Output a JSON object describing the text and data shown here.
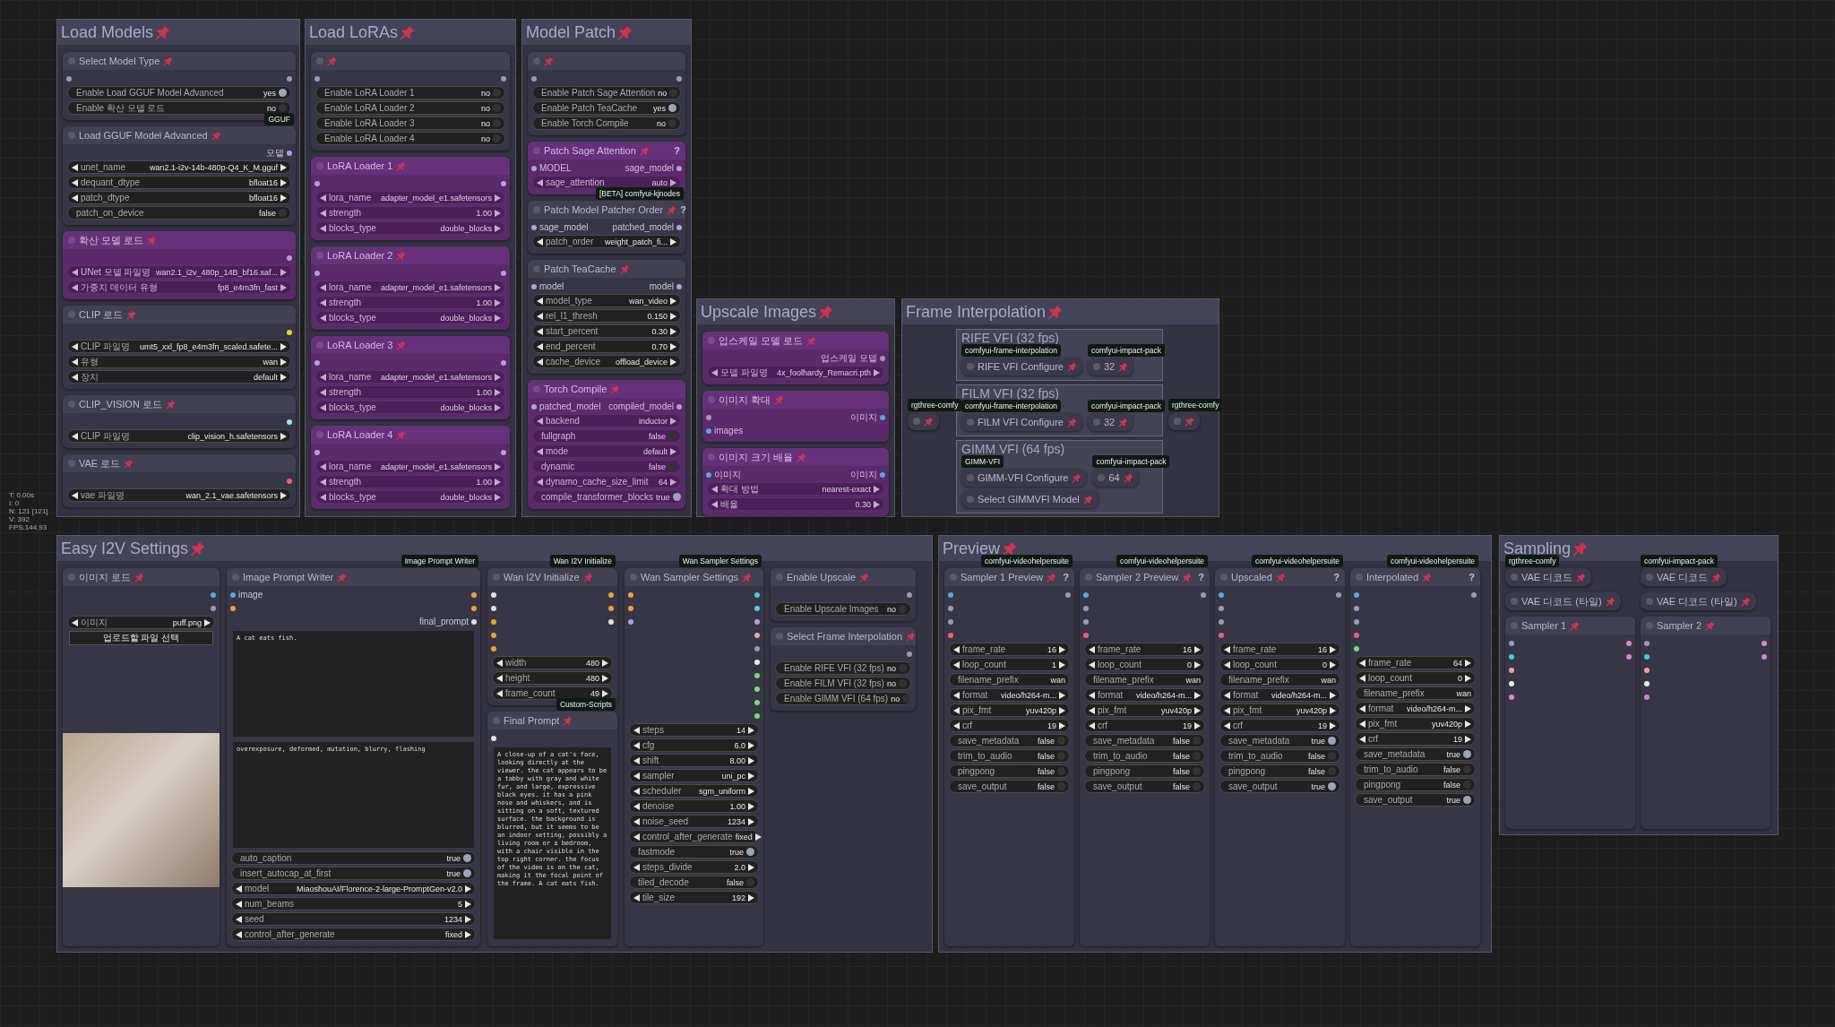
{
  "stats": [
    "T: 0.00s",
    "I: 0",
    "N: 121 [121]",
    "V: 392",
    "FPS:144.93"
  ],
  "groups": [
    {
      "title": "Load Models",
      "columns": [
        [
          {
            "kind": "node",
            "title": "Select Model Type",
            "bypassed": false,
            "inputs": [
              {
                "color": "#9a9ab0"
              }
            ],
            "outputs": [
              {
                "color": "#9a9ab0"
              }
            ],
            "widgets": [
              {
                "kind": "toggle",
                "label": "Enable Load GGUF Model Advanced",
                "value": "yes",
                "on": true
              },
              {
                "kind": "toggle",
                "label": "Enable 확산 모델 로드",
                "value": "no",
                "on": false
              }
            ]
          },
          {
            "kind": "node",
            "title": "Load GGUF Model Advanced",
            "badge": "GGUF",
            "bypassed": false,
            "outputs": [
              {
                "label": "모델",
                "color": "#b39ddb"
              }
            ],
            "widgets": [
              {
                "kind": "combo",
                "label": "unet_name",
                "value": "wan2.1-i2v-14b-480p-Q4_K_M.gguf"
              },
              {
                "kind": "combo",
                "label": "dequant_dtype",
                "value": "bfloat16"
              },
              {
                "kind": "combo",
                "label": "patch_dtype",
                "value": "bfloat16"
              },
              {
                "kind": "toggle",
                "label": "patch_on_device",
                "value": "false",
                "on": false
              }
            ]
          },
          {
            "kind": "node",
            "title": "확산 모델 로드",
            "bypassed": true,
            "outputs": [
              {
                "color": "#b39ddb"
              }
            ],
            "widgets": [
              {
                "kind": "combo",
                "label": "UNet 모델 파일명",
                "value": "wan2.1_i2v_480p_14B_bf16.saf..."
              },
              {
                "kind": "combo",
                "label": "가중치 데이터 유형",
                "value": "fp8_e4m3fn_fast"
              }
            ]
          },
          {
            "kind": "node",
            "title": "CLIP 로드",
            "bypassed": false,
            "outputs": [
              {
                "color": "#f0d020"
              }
            ],
            "widgets": [
              {
                "kind": "combo",
                "label": "CLIP 파일명",
                "value": "umt5_xxl_fp8_e4m3fn_scaled.safete..."
              },
              {
                "kind": "combo",
                "label": "유형",
                "value": "wan"
              },
              {
                "kind": "combo",
                "label": "장치",
                "value": "default"
              }
            ]
          },
          {
            "kind": "node",
            "title": "CLIP_VISION 로드",
            "bypassed": false,
            "outputs": [
              {
                "color": "#a0e0f0"
              }
            ],
            "widgets": [
              {
                "kind": "combo",
                "label": "CLIP 파일명",
                "value": "clip_vision_h.safetensors"
              }
            ]
          },
          {
            "kind": "node",
            "title": "VAE 로드",
            "bypassed": false,
            "outputs": [
              {
                "color": "#f06070"
              }
            ],
            "widgets": [
              {
                "kind": "combo",
                "label": "vae 파일명",
                "value": "wan_2.1_vae.safetensors"
              }
            ]
          }
        ]
      ]
    },
    {
      "title": "Load LoRAs",
      "columns": [
        [
          {
            "kind": "node",
            "bypassed": false,
            "inputs": [
              {
                "color": "#9a9ab0"
              }
            ],
            "outputs": [
              {
                "color": "#9a9ab0"
              }
            ],
            "widgets": [
              {
                "kind": "toggle",
                "label": "Enable LoRA Loader 1",
                "value": "no",
                "on": false
              },
              {
                "kind": "toggle",
                "label": "Enable LoRA Loader 2",
                "value": "no",
                "on": false
              },
              {
                "kind": "toggle",
                "label": "Enable LoRA Loader 3",
                "value": "no",
                "on": false
              },
              {
                "kind": "toggle",
                "label": "Enable LoRA Loader 4",
                "value": "no",
                "on": false
              }
            ]
          },
          {
            "kind": "node",
            "title": "LoRA Loader 1",
            "bypassed": true,
            "inputs": [
              {
                "color": "#b39ddb"
              }
            ],
            "outputs": [
              {
                "color": "#b39ddb"
              }
            ],
            "widgets": [
              {
                "kind": "combo",
                "label": "lora_name",
                "value": "adapter_model_e1.safetensors"
              },
              {
                "kind": "combo",
                "label": "strength",
                "value": "1.00"
              },
              {
                "kind": "combo",
                "label": "blocks_type",
                "value": "double_blocks"
              }
            ]
          },
          {
            "kind": "node",
            "title": "LoRA Loader 2",
            "bypassed": true,
            "inputs": [
              {
                "color": "#b39ddb"
              }
            ],
            "outputs": [
              {
                "color": "#b39ddb"
              }
            ],
            "widgets": [
              {
                "kind": "combo",
                "label": "lora_name",
                "value": "adapter_model_e1.safetensors"
              },
              {
                "kind": "combo",
                "label": "strength",
                "value": "1.00"
              },
              {
                "kind": "combo",
                "label": "blocks_type",
                "value": "double_blocks"
              }
            ]
          },
          {
            "kind": "node",
            "title": "LoRA Loader 3",
            "bypassed": true,
            "inputs": [
              {
                "color": "#b39ddb"
              }
            ],
            "outputs": [
              {
                "color": "#b39ddb"
              }
            ],
            "widgets": [
              {
                "kind": "combo",
                "label": "lora_name",
                "value": "adapter_model_e1.safetensors"
              },
              {
                "kind": "combo",
                "label": "strength",
                "value": "1.00"
              },
              {
                "kind": "combo",
                "label": "blocks_type",
                "value": "double_blocks"
              }
            ]
          },
          {
            "kind": "node",
            "title": "LoRA Loader 4",
            "bypassed": true,
            "inputs": [
              {
                "color": "#b39ddb"
              }
            ],
            "outputs": [
              {
                "color": "#b39ddb"
              }
            ],
            "widgets": [
              {
                "kind": "combo",
                "label": "lora_name",
                "value": "adapter_model_e1.safetensors"
              },
              {
                "kind": "combo",
                "label": "strength",
                "value": "1.00"
              },
              {
                "kind": "combo",
                "label": "blocks_type",
                "value": "double_blocks"
              }
            ]
          }
        ]
      ]
    },
    {
      "title": "Model Patch",
      "columns": [
        [
          {
            "kind": "node",
            "bypassed": false,
            "inputs": [
              {
                "color": "#9a9ab0"
              }
            ],
            "outputs": [
              {
                "color": "#9a9ab0"
              }
            ],
            "widgets": [
              {
                "kind": "toggle",
                "label": "Enable Patch Sage Attention",
                "value": "no",
                "on": false
              },
              {
                "kind": "toggle",
                "label": "Enable Patch TeaCache",
                "value": "yes",
                "on": true
              },
              {
                "kind": "toggle",
                "label": "Enable Torch Compile",
                "value": "no",
                "on": false
              }
            ]
          },
          {
            "kind": "node",
            "title": "Patch Sage Attention",
            "help": "?",
            "bypassed": true,
            "inputs": [
              {
                "label": "MODEL",
                "color": "#b39ddb"
              }
            ],
            "outputs": [
              {
                "label": "sage_model",
                "color": "#b39ddb"
              }
            ],
            "widgets": [
              {
                "kind": "combo",
                "label": "sage_attention",
                "value": "auto"
              }
            ]
          },
          {
            "kind": "node",
            "title": "Patch Model Patcher Order",
            "help": "?",
            "badge": "[BETA] comfyui-kjnodes",
            "bypassed": false,
            "inputs": [
              {
                "label": "sage_model",
                "color": "#b39ddb"
              }
            ],
            "outputs": [
              {
                "label": "patched_model",
                "color": "#b39ddb"
              }
            ],
            "widgets": [
              {
                "kind": "combo",
                "label": "patch_order",
                "value": "weight_patch_fi..."
              }
            ]
          },
          {
            "kind": "node",
            "title": "Patch TeaCache",
            "bypassed": false,
            "inputs": [
              {
                "label": "model",
                "color": "#b39ddb"
              }
            ],
            "outputs": [
              {
                "label": "model",
                "color": "#b39ddb"
              }
            ],
            "widgets": [
              {
                "kind": "combo",
                "label": "model_type",
                "value": "wan_video"
              },
              {
                "kind": "combo",
                "label": "rel_l1_thresh",
                "value": "0.150"
              },
              {
                "kind": "combo",
                "label": "start_percent",
                "value": "0.30"
              },
              {
                "kind": "combo",
                "label": "end_percent",
                "value": "0.70"
              },
              {
                "kind": "combo",
                "label": "cache_device",
                "value": "offload_device"
              }
            ]
          },
          {
            "kind": "node",
            "title": "Torch Compile",
            "bypassed": true,
            "inputs": [
              {
                "label": "patched_model",
                "color": "#b39ddb"
              }
            ],
            "outputs": [
              {
                "label": "compiled_model",
                "color": "#b39ddb"
              }
            ],
            "widgets": [
              {
                "kind": "combo",
                "label": "backend",
                "value": "inductor"
              },
              {
                "kind": "toggle",
                "label": "fullgraph",
                "value": "false",
                "on": false
              },
              {
                "kind": "combo",
                "label": "mode",
                "value": "default"
              },
              {
                "kind": "toggle",
                "label": "dynamic",
                "value": "false",
                "on": false
              },
              {
                "kind": "combo",
                "label": "dynamo_cache_size_limit",
                "value": "64"
              },
              {
                "kind": "toggle",
                "label": "compile_transformer_blocks",
                "value": "true",
                "on": true
              }
            ]
          }
        ]
      ]
    },
    {
      "title": "Upscale Images",
      "columns": [
        [
          {
            "kind": "node",
            "title": "업스케일 모델 로드",
            "bypassed": true,
            "outputs": [
              {
                "label": "업스케일 모델",
                "color": "#9a9ab0"
              }
            ],
            "widgets": [
              {
                "kind": "combo",
                "label": "모델 파일명",
                "value": "4x_foolhardy_Remacri.pth"
              }
            ]
          },
          {
            "kind": "node",
            "title": "이미지 확대",
            "bypassed": true,
            "inputs": [
              {
                "color": "#9a9ab0"
              },
              {
                "label": "images",
                "color": "#50a8f0"
              }
            ],
            "outputs": [
              {
                "label": "이미지",
                "color": "#50a8f0"
              }
            ]
          },
          {
            "kind": "node",
            "title": "이미지 크기 배율",
            "bypassed": true,
            "inputs": [
              {
                "label": "이미지",
                "color": "#50a8f0"
              }
            ],
            "outputs": [
              {
                "label": "이미지",
                "color": "#50a8f0"
              }
            ],
            "widgets": [
              {
                "kind": "combo",
                "label": "확대 방법",
                "value": "nearest-exact"
              },
              {
                "kind": "combo",
                "label": "배율",
                "value": "0.30"
              }
            ]
          }
        ]
      ]
    },
    {
      "title": "Frame Interpolation",
      "columns": [
        [
          {
            "kind": "collapsed",
            "badge": "rgthree-comfy",
            "bypassed": false
          }
        ],
        [
          {
            "kind": "group",
            "title": "RIFE VFI (32 fps)",
            "nodes": [
              {
                "kind": "collapsed",
                "title": "RIFE VFI Configure",
                "badge": "comfyui-frame-interpolation",
                "bypassed": false
              },
              {
                "kind": "collapsed",
                "title": "32",
                "badge": "comfyui-impact-pack",
                "bypassed": false
              }
            ]
          },
          {
            "kind": "group",
            "title": "FILM VFI (32 fps)",
            "nodes": [
              {
                "kind": "collapsed",
                "title": "FILM VFI Configure",
                "badge": "comfyui-frame-interpolation",
                "bypassed": false
              },
              {
                "kind": "collapsed",
                "title": "32",
                "badge": "comfyui-impact-pack",
                "bypassed": false
              }
            ]
          },
          {
            "kind": "group",
            "title": "GIMM VFI (64 fps)",
            "nodes": [
              {
                "kind": "collapsed",
                "title": "GIMM-VFI Configure",
                "badge": "GIMM-VFI",
                "bypassed": false
              },
              {
                "kind": "collapsed",
                "title": "64",
                "badge": "comfyui-impact-pack",
                "bypassed": false
              },
              {
                "kind": "collapsed",
                "title": "Select GIMMVFI Model",
                "bypassed": false
              }
            ]
          }
        ],
        [
          {
            "kind": "collapsed",
            "badge": "rgthree-comfy",
            "bypassed": false
          }
        ]
      ]
    },
    {
      "title": "Easy I2V Settings",
      "columns": [
        [
          {
            "kind": "node",
            "title": "이미지 로드",
            "bypassed": false,
            "outputs": [
              {
                "color": "#50a8f0"
              },
              {
                "color": "#9a9ab0"
              }
            ],
            "widgets": [
              {
                "kind": "combo",
                "label": "이미지",
                "value": "puff.png"
              },
              {
                "kind": "button",
                "label": "업로드할 파일 선택"
              },
              {
                "kind": "image"
              }
            ]
          }
        ],
        [
          {
            "kind": "node",
            "title": "Image Prompt Writer",
            "badge": "Image Prompt Writer",
            "bypassed": false,
            "inputs": [
              {
                "label": "image",
                "color": "#50a8f0"
              },
              {
                "color": "#f0a030"
              }
            ],
            "outputs": [
              {
                "color": "#f0a030"
              },
              {
                "color": "#f0a030"
              },
              {
                "label": "final_prompt",
                "color": "#e0e0e0"
              }
            ],
            "widgets": [
              {
                "kind": "textarea",
                "value": "A cat eats fish."
              },
              {
                "kind": "textarea",
                "value": "overexposure, deformed, mutation, blurry, flashing"
              },
              {
                "kind": "toggle",
                "label": "auto_caption",
                "value": "true",
                "on": true
              },
              {
                "kind": "toggle",
                "label": "insert_autocap_at_first",
                "value": "true",
                "on": true
              },
              {
                "kind": "combo",
                "label": "model",
                "value": "MiaoshouAI/Florence-2-large-PromptGen-v2.0"
              },
              {
                "kind": "combo",
                "label": "num_beams",
                "value": "5"
              },
              {
                "kind": "combo",
                "label": "seed",
                "value": "1234"
              },
              {
                "kind": "combo",
                "label": "control_after_generate",
                "value": "fixed"
              }
            ]
          }
        ],
        [
          {
            "kind": "node",
            "title": "Wan I2V Initialize",
            "badge": "Wan I2V Initialize",
            "bypassed": false,
            "inputs": [
              {
                "color": "#e0e0e0"
              },
              {
                "color": "#e0e0e0"
              },
              {
                "color": "#f0a030"
              },
              {
                "color": "#f0a030"
              },
              {
                "color": "#f0a030"
              }
            ],
            "outputs": [
              {
                "color": "#f0a030"
              },
              {
                "color": "#f0a030"
              },
              {
                "color": "#e0e0e0"
              }
            ],
            "widgets": [
              {
                "kind": "combo",
                "label": "width",
                "value": "480"
              },
              {
                "kind": "combo",
                "label": "height",
                "value": "480"
              },
              {
                "kind": "combo",
                "label": "frame_count",
                "value": "49"
              }
            ]
          },
          {
            "kind": "node",
            "title": "Final Prompt",
            "badge": "Custom-Scripts",
            "bypassed": false,
            "inputs": [
              {
                "color": "#e0e0e0"
              }
            ],
            "widgets": [
              {
                "kind": "textarea",
                "value": "A close-up of a cat's face, looking directly at the viewer. the cat appears to be a tabby with gray and white fur, and large, expressive black eyes. it has a pink nose and whiskers, and is sitting on a soft, textured surface. the background is blurred, but it seems to be an indoor setting, possibly a living room or a bedroom, with a chair visible in the top right corner. the focus of the video is on the cat, making it the focal point of the frame. A cat eats fish."
              }
            ]
          }
        ],
        [
          {
            "kind": "node",
            "title": "Wan Sampler Settings",
            "badge": "Wan Sampler Settings",
            "bypassed": false,
            "inputs": [
              {
                "color": "#f0a030"
              },
              {
                "color": "#f0a030"
              },
              {
                "color": "#b39ddb"
              }
            ],
            "outputs": [
              {
                "color": "#40d0e0"
              },
              {
                "color": "#40d0e0"
              },
              {
                "color": "#b39ddb"
              },
              {
                "color": "#f0a0a0"
              },
              {
                "color": "#9a9ab0"
              },
              {
                "color": "#e0f0e0"
              },
              {
                "color": "#70e070"
              },
              {
                "color": "#70e070"
              },
              {
                "color": "#70e070"
              },
              {
                "color": "#70e070"
              }
            ],
            "widgets": [
              {
                "kind": "combo",
                "label": "steps",
                "value": "14"
              },
              {
                "kind": "combo",
                "label": "cfg",
                "value": "6.0"
              },
              {
                "kind": "combo",
                "label": "shift",
                "value": "8.00"
              },
              {
                "kind": "combo",
                "label": "sampler",
                "value": "uni_pc"
              },
              {
                "kind": "combo",
                "label": "scheduler",
                "value": "sgm_uniform"
              },
              {
                "kind": "combo",
                "label": "denoise",
                "value": "1.00"
              },
              {
                "kind": "combo",
                "label": "noise_seed",
                "value": "1234"
              },
              {
                "kind": "combo",
                "label": "control_after_generate",
                "value": "fixed"
              },
              {
                "kind": "toggle",
                "label": "fastmode",
                "value": "true",
                "on": true
              },
              {
                "kind": "combo",
                "label": "steps_divide",
                "value": "2.0"
              },
              {
                "kind": "toggle",
                "label": "tiled_decode",
                "value": "false",
                "on": false
              },
              {
                "kind": "combo",
                "label": "tile_size",
                "value": "192"
              }
            ]
          }
        ],
        [
          {
            "kind": "node",
            "title": "Enable Upscale",
            "bypassed": false,
            "outputs": [
              {
                "color": "#9a9ab0"
              }
            ],
            "widgets": [
              {
                "kind": "toggle",
                "label": "Enable Upscale Images",
                "value": "no",
                "on": false
              }
            ]
          },
          {
            "kind": "node",
            "title": "Select Frame Interpolation",
            "bypassed": false,
            "outputs": [
              {
                "color": "#9a9ab0"
              }
            ],
            "widgets": [
              {
                "kind": "toggle",
                "label": "Enable RIFE VFI (32 fps)",
                "value": "no",
                "on": false
              },
              {
                "kind": "toggle",
                "label": "Enable FILM VFI (32 fps)",
                "value": "no",
                "on": false
              },
              {
                "kind": "toggle",
                "label": "Enable GIMM VFI (64 fps)",
                "value": "no",
                "on": false
              }
            ]
          }
        ]
      ]
    },
    {
      "title": "Preview",
      "columns": [
        [
          {
            "kind": "node",
            "title": "Sampler 1 Preview",
            "help": "?",
            "badge": "comfyui-videohelpersuite",
            "bypassed": false,
            "inputs": [
              {
                "color": "#50a8f0"
              },
              {
                "color": "#9a9ab0"
              },
              {
                "color": "#9a9ab0"
              },
              {
                "color": "#f06070"
              }
            ],
            "outputs": [
              {
                "color": "#9a9ab0"
              }
            ],
            "widgets": [
              {
                "kind": "combo",
                "label": "frame_rate",
                "value": "16"
              },
              {
                "kind": "combo",
                "label": "loop_count",
                "value": "1"
              },
              {
                "kind": "text",
                "label": "filename_prefix",
                "value": "wan"
              },
              {
                "kind": "combo",
                "label": "format",
                "value": "video/h264-m..."
              },
              {
                "kind": "combo",
                "label": "pix_fmt",
                "value": "yuv420p"
              },
              {
                "kind": "combo",
                "label": "crf",
                "value": "19"
              },
              {
                "kind": "toggle",
                "label": "save_metadata",
                "value": "false",
                "on": false
              },
              {
                "kind": "toggle",
                "label": "trim_to_audio",
                "value": "false",
                "on": false
              },
              {
                "kind": "toggle",
                "label": "pingpong",
                "value": "false",
                "on": false
              },
              {
                "kind": "toggle",
                "label": "save_output",
                "value": "false",
                "on": false
              }
            ]
          }
        ],
        [
          {
            "kind": "node",
            "title": "Sampler 2 Preview",
            "help": "?",
            "badge": "comfyui-videohelpersuite",
            "bypassed": false,
            "inputs": [
              {
                "color": "#50a8f0"
              },
              {
                "color": "#9a9ab0"
              },
              {
                "color": "#9a9ab0"
              },
              {
                "color": "#f06070"
              }
            ],
            "outputs": [
              {
                "color": "#9a9ab0"
              }
            ],
            "widgets": [
              {
                "kind": "combo",
                "label": "frame_rate",
                "value": "16"
              },
              {
                "kind": "combo",
                "label": "loop_count",
                "value": "0"
              },
              {
                "kind": "text",
                "label": "filename_prefix",
                "value": "wan"
              },
              {
                "kind": "combo",
                "label": "format",
                "value": "video/h264-m..."
              },
              {
                "kind": "combo",
                "label": "pix_fmt",
                "value": "yuv420p"
              },
              {
                "kind": "combo",
                "label": "crf",
                "value": "19"
              },
              {
                "kind": "toggle",
                "label": "save_metadata",
                "value": "false",
                "on": false
              },
              {
                "kind": "toggle",
                "label": "trim_to_audio",
                "value": "false",
                "on": false
              },
              {
                "kind": "toggle",
                "label": "pingpong",
                "value": "false",
                "on": false
              },
              {
                "kind": "toggle",
                "label": "save_output",
                "value": "false",
                "on": false
              }
            ]
          }
        ],
        [
          {
            "kind": "node",
            "title": "Upscaled",
            "help": "?",
            "badge": "comfyui-videohelpersuite",
            "bypassed": false,
            "inputs": [
              {
                "color": "#50a8f0"
              },
              {
                "color": "#9a9ab0"
              },
              {
                "color": "#9a9ab0"
              },
              {
                "color": "#f06070"
              }
            ],
            "outputs": [
              {
                "color": "#9a9ab0"
              }
            ],
            "widgets": [
              {
                "kind": "combo",
                "label": "frame_rate",
                "value": "16"
              },
              {
                "kind": "combo",
                "label": "loop_count",
                "value": "0"
              },
              {
                "kind": "text",
                "label": "filename_prefix",
                "value": "wan"
              },
              {
                "kind": "combo",
                "label": "format",
                "value": "video/h264-m..."
              },
              {
                "kind": "combo",
                "label": "pix_fmt",
                "value": "yuv420p"
              },
              {
                "kind": "combo",
                "label": "crf",
                "value": "19"
              },
              {
                "kind": "toggle",
                "label": "save_metadata",
                "value": "true",
                "on": true
              },
              {
                "kind": "toggle",
                "label": "trim_to_audio",
                "value": "false",
                "on": false
              },
              {
                "kind": "toggle",
                "label": "pingpong",
                "value": "false",
                "on": false
              },
              {
                "kind": "toggle",
                "label": "save_output",
                "value": "true",
                "on": true
              }
            ]
          }
        ],
        [
          {
            "kind": "node",
            "title": "Interpolated",
            "help": "?",
            "badge": "comfyui-videohelpersuite",
            "bypassed": false,
            "inputs": [
              {
                "color": "#50a8f0"
              },
              {
                "color": "#9a9ab0"
              },
              {
                "color": "#9a9ab0"
              },
              {
                "color": "#f06070"
              },
              {
                "color": "#70e070"
              }
            ],
            "outputs": [
              {
                "color": "#9a9ab0"
              }
            ],
            "widgets": [
              {
                "kind": "combo",
                "label": "frame_rate",
                "value": "64"
              },
              {
                "kind": "combo",
                "label": "loop_count",
                "value": "0"
              },
              {
                "kind": "text",
                "label": "filename_prefix",
                "value": "wan"
              },
              {
                "kind": "combo",
                "label": "format",
                "value": "video/h264-m..."
              },
              {
                "kind": "combo",
                "label": "pix_fmt",
                "value": "yuv420p"
              },
              {
                "kind": "combo",
                "label": "crf",
                "value": "19"
              },
              {
                "kind": "toggle",
                "label": "save_metadata",
                "value": "true",
                "on": true
              },
              {
                "kind": "toggle",
                "label": "trim_to_audio",
                "value": "false",
                "on": false
              },
              {
                "kind": "toggle",
                "label": "pingpong",
                "value": "false",
                "on": false
              },
              {
                "kind": "toggle",
                "label": "save_output",
                "value": "true",
                "on": true
              }
            ]
          }
        ]
      ]
    },
    {
      "title": "Sampling",
      "columns": [
        [
          {
            "kind": "collapsed",
            "title": "VAE 디코드",
            "badge": "rgthree-comfy",
            "bypassed": false
          },
          {
            "kind": "collapsed",
            "title": "VAE 디코드 (타일)",
            "bypassed": false
          },
          {
            "kind": "node",
            "title": "Sampler 1",
            "bypassed": false,
            "inputs": [
              {
                "color": "#9a9ab0"
              },
              {
                "color": "#40d0e0"
              },
              {
                "color": "#f0a0a0"
              },
              {
                "color": "#e0f0e0"
              },
              {
                "color": "#e080d0"
              }
            ],
            "outputs": [
              {
                "color": "#e080d0"
              },
              {
                "color": "#e080d0"
              }
            ]
          }
        ],
        [
          {
            "kind": "collapsed",
            "title": "VAE 디코드",
            "badge": "comfyui-impact-pack",
            "bypassed": false
          },
          {
            "kind": "collapsed",
            "title": "VAE 디코드 (타일)",
            "bypassed": false
          },
          {
            "kind": "node",
            "title": "Sampler 2",
            "bypassed": false,
            "inputs": [
              {
                "color": "#9a9ab0"
              },
              {
                "color": "#40d0e0"
              },
              {
                "color": "#f0a0a0"
              },
              {
                "color": "#e0f0e0"
              },
              {
                "color": "#e080d0"
              }
            ],
            "outputs": [
              {
                "color": "#e080d0"
              },
              {
                "color": "#e080d0"
              }
            ]
          }
        ]
      ]
    }
  ]
}
